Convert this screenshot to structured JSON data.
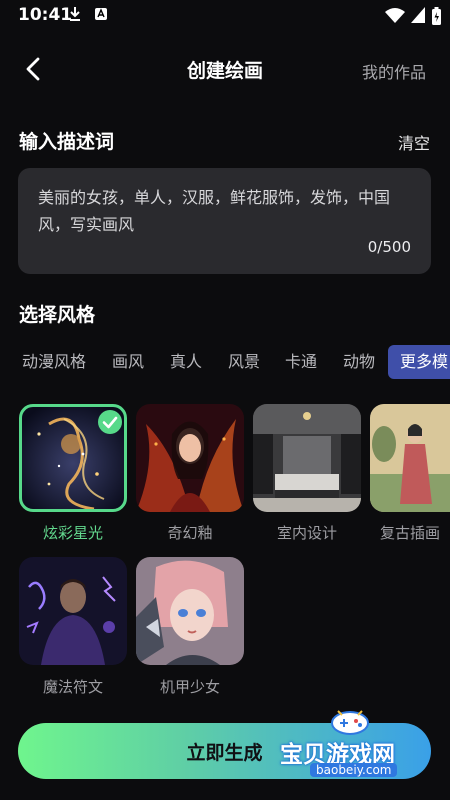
{
  "status": {
    "time": "10:41"
  },
  "header": {
    "title": "创建绘画",
    "my_works": "我的作品"
  },
  "prompt": {
    "section_label": "输入描述词",
    "clear_label": "清空",
    "text": "美丽的女孩，单人，汉服，鲜花服饰，发饰，中国风，写实画风",
    "counter": "0/500"
  },
  "style": {
    "section_label": "选择风格",
    "tabs": [
      "动漫风格",
      "画风",
      "真人",
      "风景",
      "卡通",
      "动物",
      "更多模"
    ],
    "active_tab": "更多模",
    "cards": [
      "炫彩星光",
      "奇幻釉",
      "室内设计",
      "复古插画",
      "魔法符文",
      "机甲少女"
    ],
    "selected_card": "炫彩星光"
  },
  "generate": {
    "label": "立即生成"
  },
  "watermark": {
    "text": "宝贝游戏网",
    "url": "baobeiy.com"
  },
  "colors": {
    "accent_green": "#57d98a",
    "tab_active": "#3f4fa9",
    "background": "#0c0c0e"
  }
}
